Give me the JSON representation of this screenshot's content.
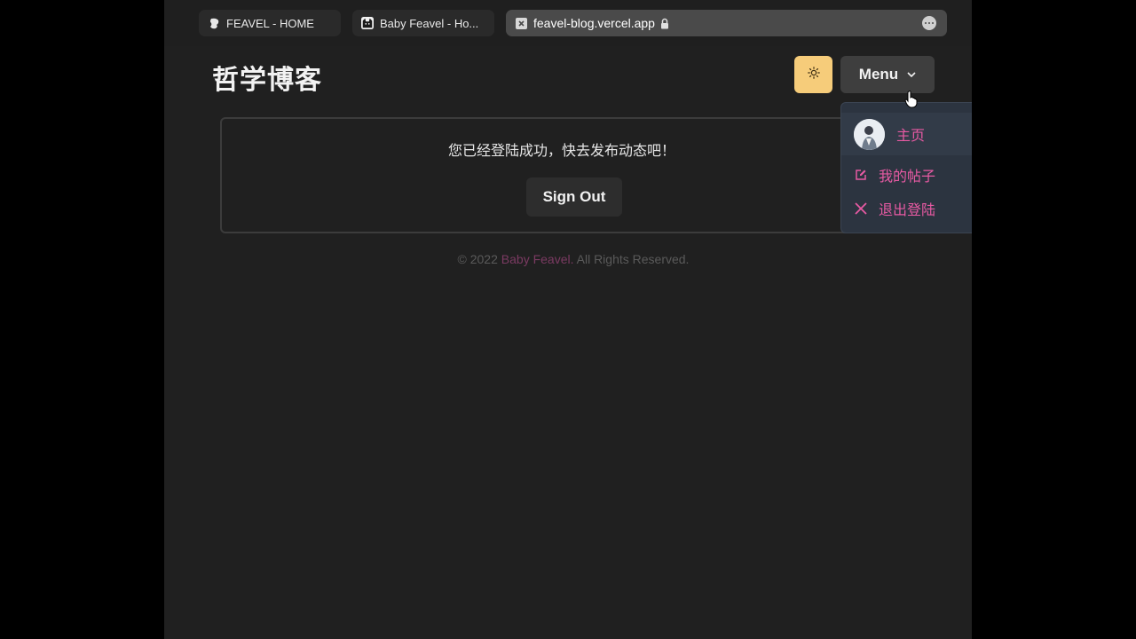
{
  "browser": {
    "tabs": [
      {
        "label": "FEAVEL - HOME",
        "icon": "feavel-logo-icon"
      },
      {
        "label": "Baby Feavel - Ho...",
        "icon": "cat-icon"
      }
    ],
    "address": {
      "url": "feavel-blog.vercel.app",
      "icon": "site-favicon-icon",
      "secure_icon": "lock-icon",
      "more_icon": "more-icon"
    }
  },
  "header": {
    "site_title": "哲学博客",
    "theme_toggle_icon": "sun-icon",
    "menu_label": "Menu",
    "menu_icon": "chevron-down-icon"
  },
  "main": {
    "message": "您已经登陆成功，快去发布动态吧！",
    "sign_out_label": "Sign Out"
  },
  "footer": {
    "prefix": "© 2022 ",
    "brand": "Baby Feavel.",
    "suffix": " All Rights Reserved."
  },
  "dropdown": {
    "items": [
      {
        "label": "主页",
        "icon": "avatar"
      },
      {
        "label": "我的帖子",
        "icon": "edit-icon"
      },
      {
        "label": "退出登陆",
        "icon": "close-icon"
      }
    ]
  },
  "colors": {
    "accent_pink": "#e75aa3",
    "theme_button": "#f6cc7a",
    "background": "#202020"
  }
}
